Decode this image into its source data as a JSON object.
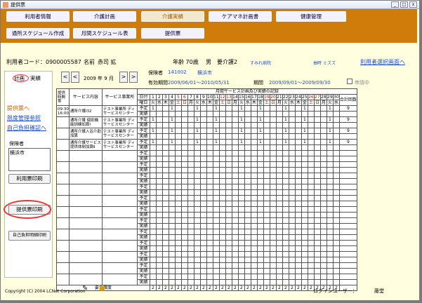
{
  "window": {
    "title": "提供票"
  },
  "nav": {
    "row1": [
      "利用者情報",
      "介護計画",
      "介護実績",
      "ケアマネ計画書",
      "健康管理"
    ],
    "row2": [
      "通所スケジュール作成",
      "月間スケジュール表",
      "提供票"
    ]
  },
  "user": {
    "code": "利用者コード：0900005587",
    "name_label": "名前",
    "name": "赤司 拡",
    "age": "年齢 70歳",
    "sex": "男",
    "care": "要介護2",
    "facility": "すみれ病院",
    "rep": "抽時 ミズズ",
    "select_link": "利用者選択画面へ"
  },
  "left": {
    "tab1": "計画",
    "tab2": "実績",
    "link1": "提供票へ",
    "link2": "限度管理参照",
    "link3": "自己負担確認へ",
    "insurer_label": "保険者",
    "insurer_item": "横浜市",
    "btn_riyo": "利用票印刷",
    "btn_teikyo": "提供票印刷",
    "btn_jiko": "自己負担明細印刷"
  },
  "ctl": {
    "prev_year": "<",
    "prev_month": "<",
    "ym": "2009 年 9 月",
    "next_month": ">",
    "next_year": ">",
    "hoken_label": "保険者",
    "hoken_no": "141002",
    "hoken_name": "横浜市",
    "yuko_label": "有効期間",
    "yuko": "2009/06/01～2010/05/31",
    "kikan_label": "期間",
    "kikan": "2009/09/01～2009/09/30",
    "shinsei": "申請中"
  },
  "grid": {
    "title": "月間サービス計画及び実績の記録",
    "h_time": "提供時間帯",
    "h_service": "サービス内容",
    "h_office": "サービス事業所",
    "h_date": "日付",
    "h_dow": "曜日",
    "h_total": "合計回数",
    "days": [
      "1",
      "2",
      "3",
      "4",
      "5",
      "6",
      "7",
      "8",
      "9",
      "10",
      "11",
      "12",
      "13",
      "14",
      "15",
      "16",
      "17",
      "18",
      "19",
      "20",
      "21",
      "22",
      "23",
      "24",
      "25",
      "26",
      "27",
      "28",
      "29",
      "30"
    ],
    "dows": [
      "火",
      "水",
      "木",
      "金",
      "土",
      "日",
      "月",
      "火",
      "水",
      "木",
      "金",
      "土",
      "日",
      "月",
      "火",
      "水",
      "木",
      "金",
      "土",
      "日",
      "月",
      "火",
      "水",
      "木",
      "金",
      "土",
      "日",
      "月",
      "火",
      "水"
    ],
    "plan": "予定",
    "result": "実績",
    "time": "09:30 16:00",
    "rows": [
      {
        "service": "通所介護Ⅰ32",
        "office": "テスト事業所 ディサービスセンター",
        "total": "9"
      },
      {
        "service": "通所介護 個別機能訓練加算Ⅰ",
        "office": "テスト事業所 ディサービスセンター",
        "total": "9"
      },
      {
        "service": "通所介護入浴介助加算",
        "office": "テスト事業所 ディサービスセンター",
        "total": "9"
      },
      {
        "service": "通所介護サービス提供体制加算Ⅱ",
        "office": "テスト事業所 ディサービスセンター",
        "total": "9"
      }
    ],
    "plan_days": [
      0,
      3,
      7,
      10,
      14,
      17,
      21,
      24,
      28
    ],
    "kaigodo_label": "要介護度",
    "kaigodo": "2"
  },
  "footer": {
    "copyright": "Copyright (C) 2004 LCNet Corporation",
    "login_label": "ログインユーザー：",
    "login_user": "藤堂"
  }
}
